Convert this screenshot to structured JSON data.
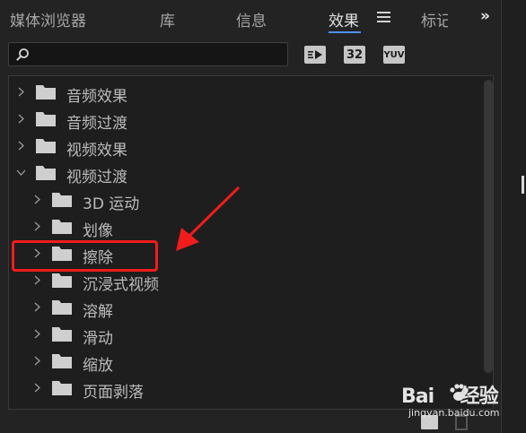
{
  "tabs": [
    {
      "label": "媒体浏览器",
      "active": false
    },
    {
      "label": "库",
      "active": false
    },
    {
      "label": "信息",
      "active": false
    },
    {
      "label": "效果",
      "active": true
    },
    {
      "label": "标记",
      "active": false
    }
  ],
  "overflow_label": "»",
  "search": {
    "value": "",
    "placeholder": ""
  },
  "filters": [
    {
      "icon": "accelerated-effects-icon",
      "label": ""
    },
    {
      "icon": "32-bit-color-icon",
      "label": "32"
    },
    {
      "icon": "yuv-effects-icon",
      "label": "YUV"
    }
  ],
  "tree": [
    {
      "label": "音频效果",
      "level": 0,
      "expanded": false
    },
    {
      "label": "音频过渡",
      "level": 0,
      "expanded": false
    },
    {
      "label": "视频效果",
      "level": 0,
      "expanded": false
    },
    {
      "label": "视频过渡",
      "level": 0,
      "expanded": true
    },
    {
      "label": "3D 运动",
      "level": 1,
      "expanded": false
    },
    {
      "label": "划像",
      "level": 1,
      "expanded": false
    },
    {
      "label": "擦除",
      "level": 1,
      "expanded": false
    },
    {
      "label": "沉浸式视频",
      "level": 1,
      "expanded": false
    },
    {
      "label": "溶解",
      "level": 1,
      "expanded": false
    },
    {
      "label": "滑动",
      "level": 1,
      "expanded": false
    },
    {
      "label": "缩放",
      "level": 1,
      "expanded": false
    },
    {
      "label": "页面剥落",
      "level": 1,
      "expanded": false
    }
  ],
  "annotation": {
    "highlighted_item": "擦除",
    "color": "#f21c1c"
  },
  "watermark": {
    "logo": "Bai经验",
    "url": "jingyan.baidu.com"
  },
  "colors": {
    "accent": "#4d8ff7",
    "panel": "#232323",
    "tree_bg": "#1e1e1e"
  }
}
